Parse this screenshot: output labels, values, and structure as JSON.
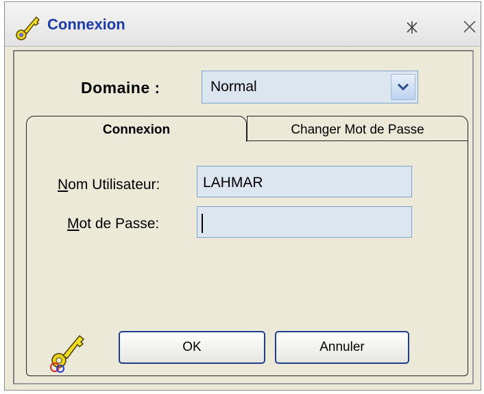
{
  "window": {
    "title": "Connexion",
    "title_color": "#1c3aa8",
    "icons": {
      "title": "key-icon",
      "pin": "pin-icon",
      "close": "close-icon"
    }
  },
  "domain": {
    "label": "Domaine :",
    "selected": "Normal"
  },
  "tabs": [
    {
      "label": "Connexion",
      "active": true
    },
    {
      "label": "Changer Mot de Passe",
      "active": false
    }
  ],
  "form": {
    "username": {
      "label_access_key": "N",
      "label_rest": "om Utilisateur:",
      "value": "LAHMAR"
    },
    "password": {
      "label_access_key": "M",
      "label_rest": "ot de Passe:",
      "value": ""
    }
  },
  "buttons": {
    "ok": "OK",
    "cancel": "Annuler"
  },
  "colors": {
    "dialog_bg": "#ece9d8",
    "input_bg": "#dbe6f1",
    "input_border": "#7ea2cf",
    "button_border": "#1e3c8c"
  }
}
